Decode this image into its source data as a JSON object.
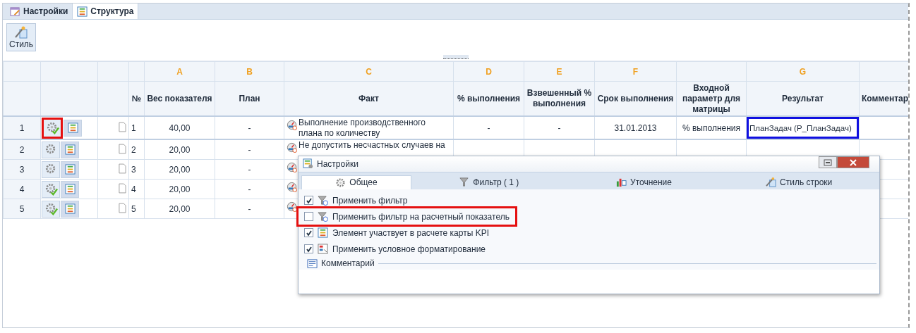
{
  "tabs": [
    {
      "label": "Настройки",
      "selected": false,
      "kind": "settings"
    },
    {
      "label": "Структура",
      "selected": true,
      "kind": "structure"
    }
  ],
  "toolbar": {
    "style_button": "Стиль"
  },
  "table": {
    "columns": [
      {},
      {},
      {},
      {
        "title": "№"
      },
      {
        "letter": "A",
        "title": "Вес показателя"
      },
      {
        "letter": "B",
        "title": "План"
      },
      {
        "letter": "C",
        "title": "Факт"
      },
      {
        "letter": "D",
        "title": "% выполнения"
      },
      {
        "letter": "E",
        "title": "Взвешенный % выполнения"
      },
      {
        "letter": "F",
        "title": "Срок выполнения"
      },
      {
        "title": "Входной параметр для матрицы"
      },
      {
        "letter": "G",
        "title": "Результат"
      },
      {
        "title": "Комментар"
      }
    ],
    "rows": [
      {
        "row_number": "1",
        "configured": true,
        "highlighted": true,
        "number": "1",
        "weight": "40,00",
        "plan": "-",
        "fact": "Выполнение производственного плана по количеству",
        "percent": "-",
        "weighted": "-",
        "deadline": "31.01.2013",
        "input_param": "% выполнения",
        "result": "ПланЗадач (P_ПланЗадач)",
        "result_highlighted": true
      },
      {
        "row_number": "2",
        "configured": false,
        "highlighted": false,
        "number": "2",
        "weight": "20,00",
        "plan": "-",
        "fact": "Не допустить несчастных случаев на"
      },
      {
        "row_number": "3",
        "configured": false,
        "highlighted": false,
        "number": "3",
        "weight": "20,00",
        "plan": "-"
      },
      {
        "row_number": "4",
        "configured": true,
        "highlighted": false,
        "number": "4",
        "weight": "20,00",
        "plan": "-"
      },
      {
        "row_number": "5",
        "configured": true,
        "highlighted": false,
        "number": "5",
        "weight": "20,00",
        "plan": "-"
      }
    ]
  },
  "dialog": {
    "title": "Настройки",
    "tabs": [
      {
        "label": "Общее",
        "selected": true,
        "kind": "general"
      },
      {
        "label": "Фильтр ( 1 )",
        "selected": false,
        "kind": "filter"
      },
      {
        "label": "Уточнение",
        "selected": false,
        "kind": "refine"
      },
      {
        "label": "Стиль строки",
        "selected": false,
        "kind": "style"
      }
    ],
    "options": [
      {
        "label": "Применить фильтр",
        "checked": true,
        "kind": "filter",
        "highlighted": false
      },
      {
        "label": "Применить фильтр на расчетный показатель",
        "checked": false,
        "kind": "filter",
        "highlighted": true
      },
      {
        "label": "Элемент участвует в расчете карты KPI",
        "checked": true,
        "kind": "kpi",
        "highlighted": false
      },
      {
        "label": "Применить условное форматирование",
        "checked": true,
        "kind": "format",
        "highlighted": false
      }
    ],
    "comment": {
      "label": "Комментарий"
    }
  }
}
